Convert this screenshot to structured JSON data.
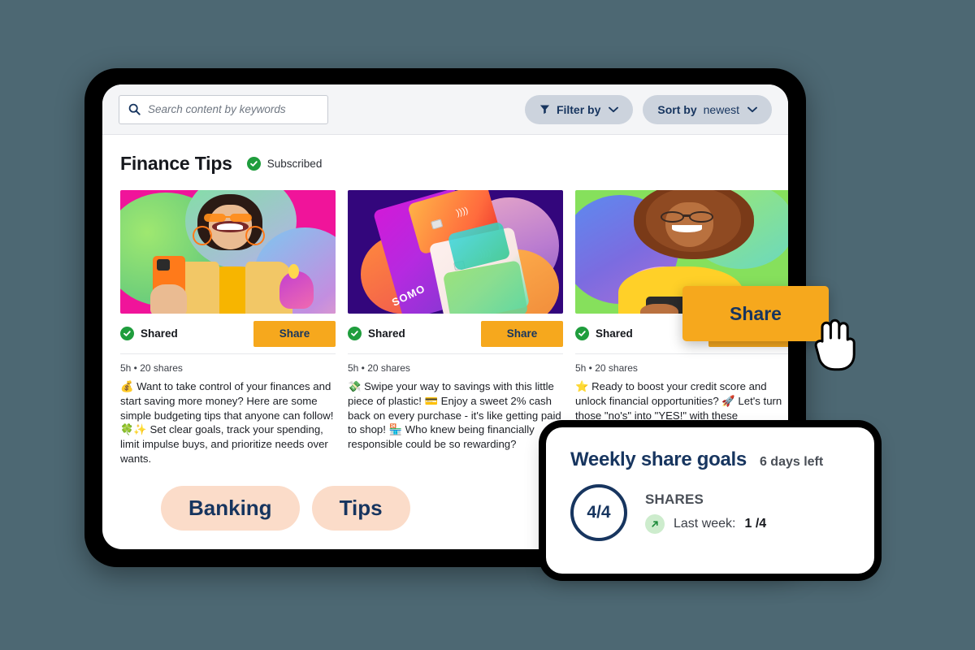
{
  "theme": {
    "background": "#4d6873",
    "accent_orange": "#f6a81d",
    "navy": "#17355f",
    "pill_grey": "#ccd3dd",
    "tag_peach": "#fbdcc9",
    "green_check": "#1f9d3d"
  },
  "topbar": {
    "search": {
      "icon": "search-icon",
      "placeholder": "Search content by keywords",
      "value": ""
    },
    "filter": {
      "icon": "filter-icon",
      "label": "Filter by",
      "chevron": "chevron-down-icon"
    },
    "sort": {
      "label_strong": "Sort by",
      "label_value": "newest",
      "chevron": "chevron-down-icon"
    }
  },
  "header": {
    "title": "Finance Tips",
    "subscription": {
      "icon": "check-circle-icon",
      "label": "Subscribed"
    }
  },
  "cards": [
    {
      "image_alt": "woman-with-orange-phone",
      "shared_icon": "check-circle-icon",
      "shared_label": "Shared",
      "share_button": "Share",
      "meta": "5h  •  20 shares",
      "text": "💰 Want to take control of your finances and start saving more money? Here are some simple budgeting tips that anyone can follow! 🍀✨ Set clear goals, track your spending, limit impulse buys, and prioritize needs over wants."
    },
    {
      "image_alt": "colorful-credit-cards",
      "shared_icon": "check-circle-icon",
      "shared_label": "Shared",
      "share_button": "Share",
      "meta": "5h  •  20 shares",
      "text": "💸 Swipe your way to savings with this little piece of plastic! 💳 Enjoy a sweet 2% cash back on every purchase - it's like getting paid to shop! 🏪 Who knew being financially responsible could be so rewarding?"
    },
    {
      "image_alt": "woman-in-yellow-shirt-with-phone",
      "shared_icon": "check-circle-icon",
      "shared_label": "Shared",
      "share_button": "Share",
      "meta": "5h  •  20 shares",
      "text": "⭐ Ready to boost your credit score and unlock financial opportunities? 🚀 Let's turn those \"no's\" into \"YES!\" with these"
    }
  ],
  "tags": [
    {
      "label": "Banking"
    },
    {
      "label": "Tips"
    }
  ],
  "floating_share": {
    "label": "Share",
    "cursor": "pointing-hand-cursor"
  },
  "goals_panel": {
    "title": "Weekly share goals",
    "days_left": "6 days left",
    "ring_value": "4/4",
    "stat_label": "SHARES",
    "trend_icon": "arrow-up-right-icon",
    "last_week_prefix": "Last week:",
    "last_week_value": "1 /4"
  }
}
